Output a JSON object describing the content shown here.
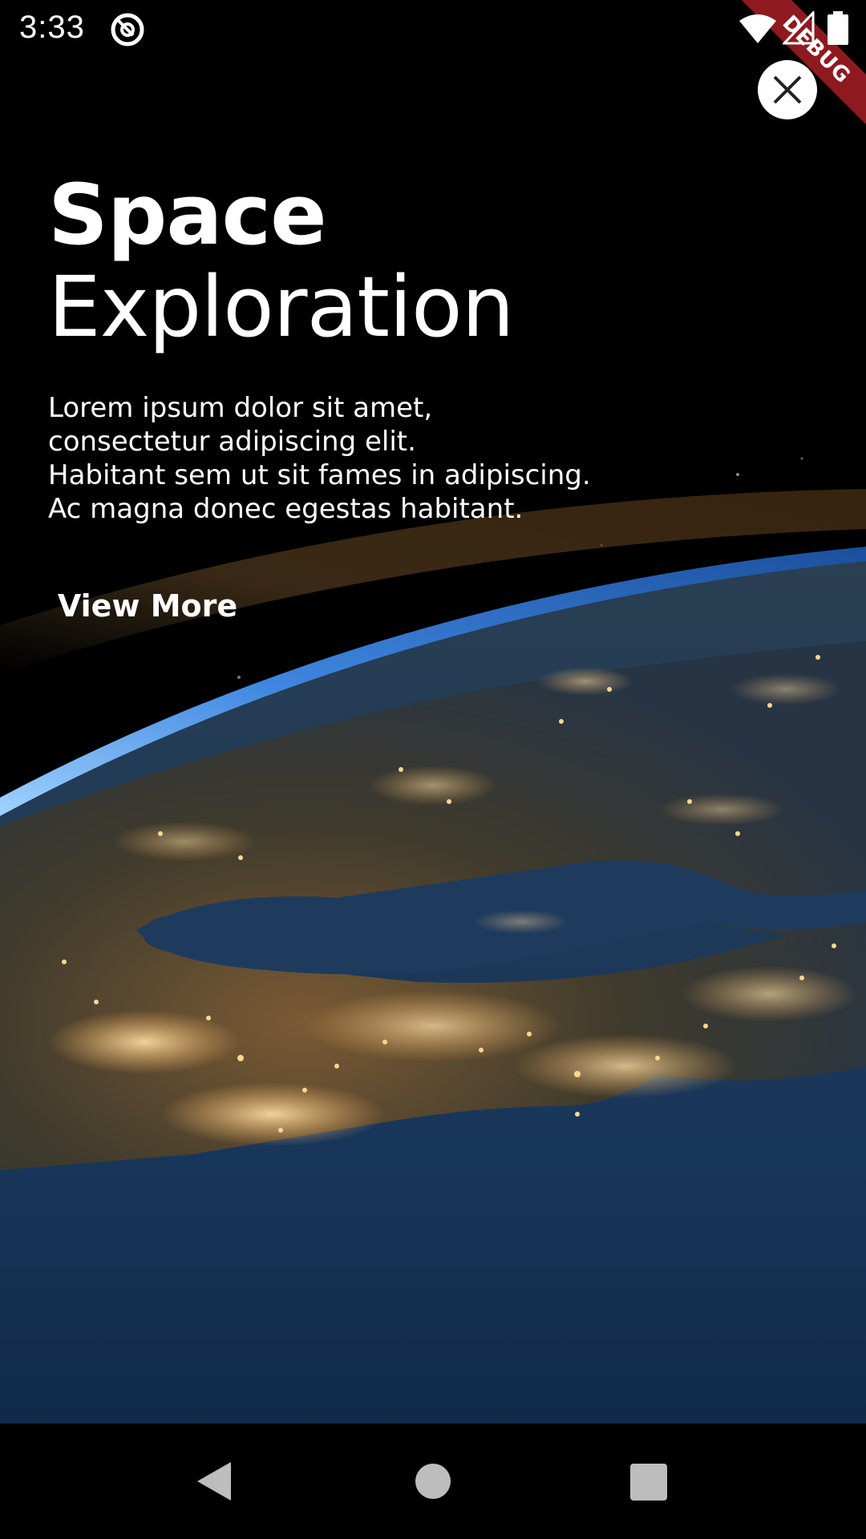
{
  "status_bar": {
    "time": "3:33",
    "icons": [
      "app-notification-icon",
      "wifi-icon",
      "cell-signal-icon",
      "battery-icon"
    ]
  },
  "debug_banner": {
    "label": "DEBUG",
    "color": "#8e1a1f"
  },
  "close_button": {
    "icon": "close-icon"
  },
  "hero": {
    "title_bold": "Space",
    "title_regular": "Exploration",
    "description_lines": [
      "Lorem ipsum dolor sit amet,",
      "consectetur adipiscing elit.",
      "Habitant sem ut sit fames in adipiscing.",
      "Ac magna donec egestas habitant."
    ],
    "cta_label": "View More"
  },
  "background": {
    "subject": "earth-at-night-from-orbit"
  },
  "nav_bar": {
    "icons": [
      "back-icon",
      "home-icon",
      "recents-icon"
    ]
  },
  "colors": {
    "text": "#ffffff",
    "background": "#000000",
    "ocean": "#1d3a5c",
    "city_lights": "#ffcf85",
    "atmosphere": "#5aa7ff"
  }
}
